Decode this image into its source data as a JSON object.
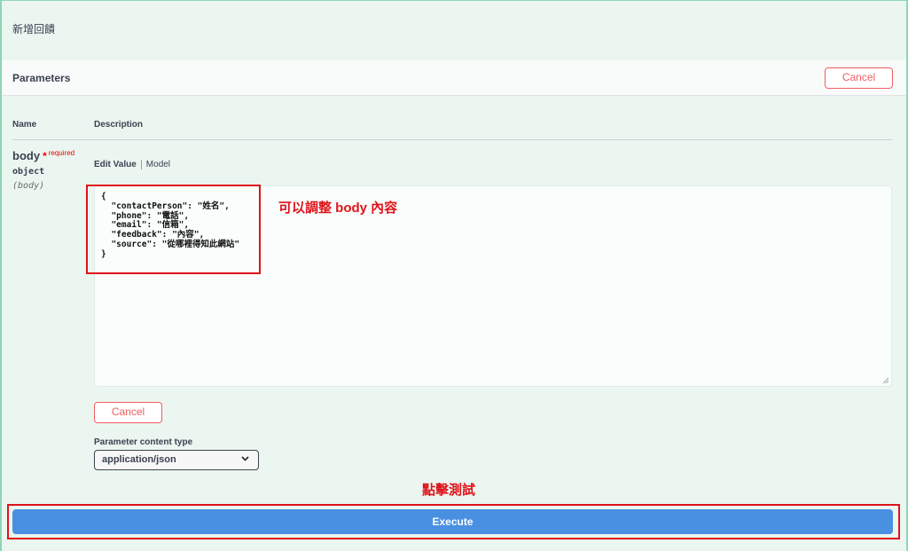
{
  "operation": {
    "title": "新增回饋"
  },
  "parameters": {
    "title": "Parameters",
    "cancel_label": "Cancel",
    "col_name": "Name",
    "col_description": "Description"
  },
  "param": {
    "name": "body",
    "required_star": "*",
    "required_label": "required",
    "type": "object",
    "in": "(body)"
  },
  "editor": {
    "tab_edit_value": "Edit Value",
    "tab_model": "Model",
    "body_value": "{\n  \"contactPerson\": \"姓名\",\n  \"phone\": \"電話\",\n  \"email\": \"信箱\",\n  \"feedback\": \"內容\",\n  \"source\": \"從哪裡得知此網站\"\n}",
    "cancel_label": "Cancel"
  },
  "content_type": {
    "label": "Parameter content type",
    "selected": "application/json"
  },
  "execute": {
    "label": "Execute"
  },
  "annotations": {
    "edit_hint": "可以調整 body 內容",
    "click_hint": "點擊測試"
  },
  "colors": {
    "background": "#ebf6f0",
    "execute": "#4990e2",
    "cancel": "#ef5e62",
    "annotation": "#e0131a"
  }
}
